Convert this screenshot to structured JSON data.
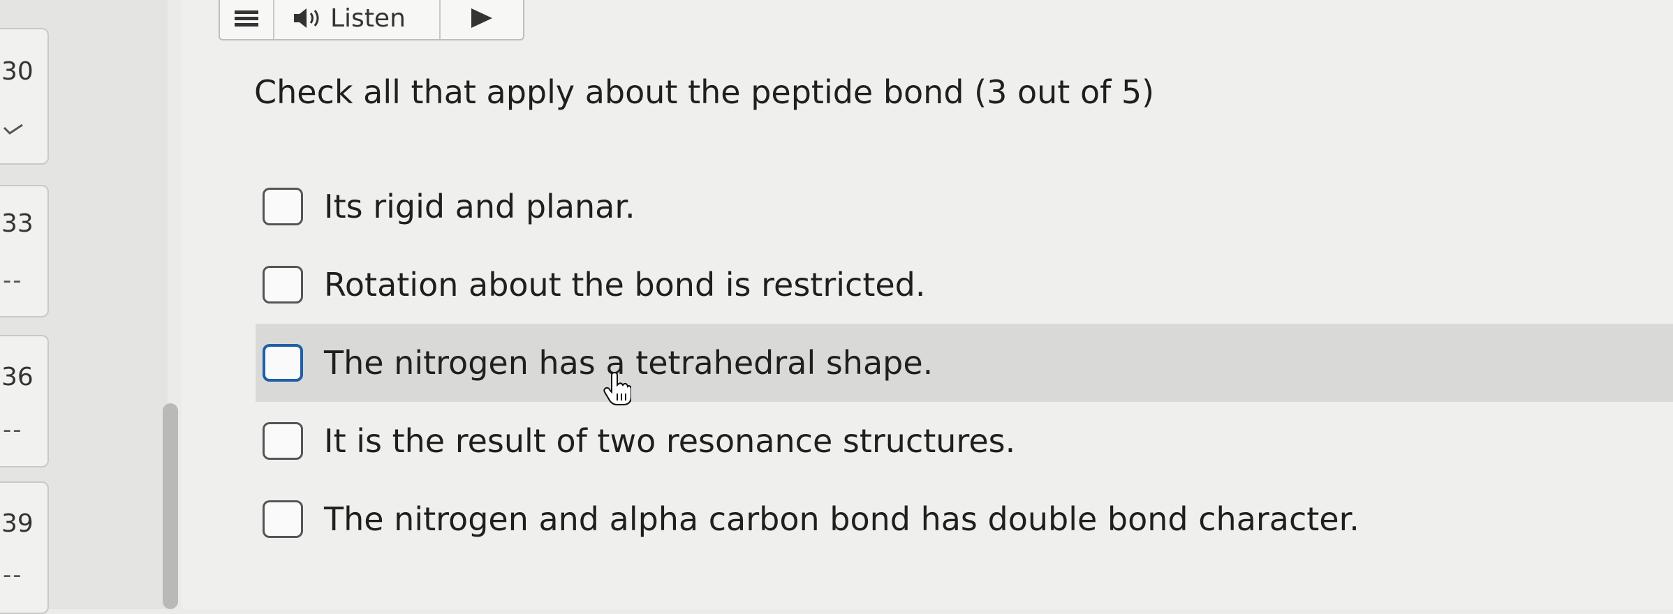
{
  "toolbar": {
    "listen_label": "Listen",
    "menu_icon": "hamburger-icon",
    "speaker_icon": "speaker-icon",
    "play_icon": "play-icon"
  },
  "nav": {
    "questions": [
      {
        "number": "30",
        "status": "✓"
      },
      {
        "number": "33",
        "status": "--"
      },
      {
        "number": "36",
        "status": "--"
      },
      {
        "number": "39",
        "status": "--"
      }
    ]
  },
  "question": {
    "text": "Check all that apply about the peptide bond (3 out of 5)",
    "options": [
      {
        "label": "Its rigid and planar.",
        "checked": false
      },
      {
        "label": "Rotation about the bond is restricted.",
        "checked": false
      },
      {
        "label": "The nitrogen has a tetrahedral shape.",
        "checked": false
      },
      {
        "label": "It is the result of two resonance structures.",
        "checked": false
      },
      {
        "label": "The nitrogen and alpha carbon bond has double bond character.",
        "checked": false
      }
    ]
  },
  "colors": {
    "focus_border": "#1f5fa8",
    "hover_row": "#d9d9d7"
  }
}
